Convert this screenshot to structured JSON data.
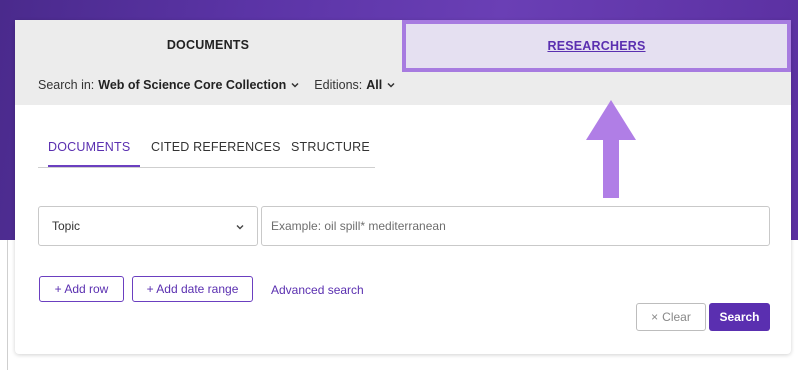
{
  "tabs": {
    "documents_label": "DOCUMENTS",
    "researchers_label": "RESEARCHERS"
  },
  "search_in": {
    "prefix": "Search in:",
    "collection": "Web of Science Core Collection",
    "editions_prefix": "Editions:",
    "editions_value": "All"
  },
  "subtabs": [
    {
      "label": "DOCUMENTS",
      "active": true
    },
    {
      "label": "CITED REFERENCES",
      "active": false
    },
    {
      "label": "STRUCTURE",
      "active": false
    }
  ],
  "query": {
    "field_selected": "Topic",
    "placeholder": "Example: oil spill* mediterranean",
    "value": ""
  },
  "actions": {
    "add_row": "+ Add row",
    "add_date_range": "+ Add date range",
    "advanced_search": "Advanced search",
    "clear_icon": "×",
    "clear": "Clear",
    "search": "Search"
  },
  "colors": {
    "brand_purple": "#5a2fb0",
    "highlight_purple": "#a77be0",
    "banner": "#5b34a6"
  },
  "icons": [
    "chevron-down-icon",
    "close-icon",
    "up-arrow-annotation"
  ]
}
